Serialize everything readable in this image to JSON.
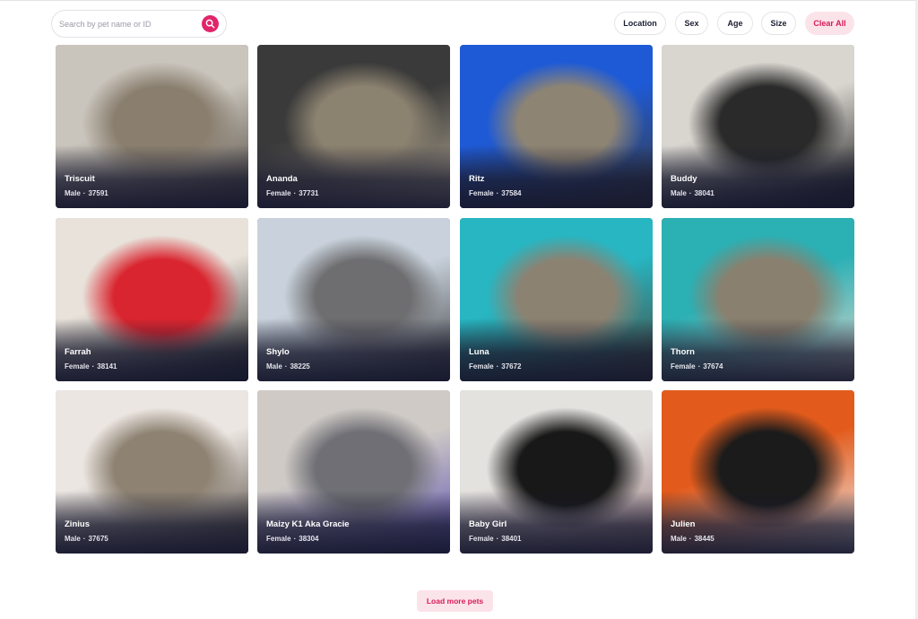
{
  "search": {
    "placeholder": "Search by pet name or ID",
    "value": ""
  },
  "filters": {
    "location": "Location",
    "sex": "Sex",
    "age": "Age",
    "size": "Size",
    "clear": "Clear All"
  },
  "pets": [
    {
      "name": "Triscuit",
      "sex": "Male",
      "id": "37591"
    },
    {
      "name": "Ananda",
      "sex": "Female",
      "id": "37731"
    },
    {
      "name": "Ritz",
      "sex": "Female",
      "id": "37584"
    },
    {
      "name": "Buddy",
      "sex": "Male",
      "id": "38041"
    },
    {
      "name": "Farrah",
      "sex": "Female",
      "id": "38141"
    },
    {
      "name": "Shylo",
      "sex": "Male",
      "id": "38225"
    },
    {
      "name": "Luna",
      "sex": "Female",
      "id": "37672"
    },
    {
      "name": "Thorn",
      "sex": "Female",
      "id": "37674"
    },
    {
      "name": "Zinius",
      "sex": "Male",
      "id": "37675"
    },
    {
      "name": "Maizy K1 Aka Gracie",
      "sex": "Female",
      "id": "38304"
    },
    {
      "name": "Baby Girl",
      "sex": "Female",
      "id": "38401"
    },
    {
      "name": "Julien",
      "sex": "Male",
      "id": "38445"
    }
  ],
  "meta_separator": "·",
  "load_more": "Load more pets",
  "colors": {
    "accent": "#e0266b",
    "accent_soft": "#fbe3ea",
    "card_shade": "#16182e"
  }
}
